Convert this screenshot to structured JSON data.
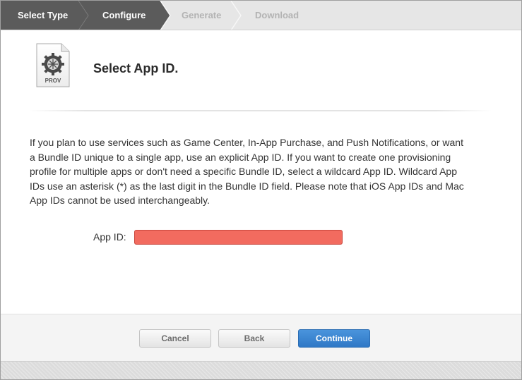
{
  "steps": [
    {
      "label": "Select Type",
      "state": "done"
    },
    {
      "label": "Configure",
      "state": "done"
    },
    {
      "label": "Generate",
      "state": "todo"
    },
    {
      "label": "Download",
      "state": "todo"
    }
  ],
  "colors": {
    "step_done": "#5b5b5b",
    "step_todo": "#e6e6e6",
    "app_id_field": "#f26b5f",
    "primary_button": "#2f78c6"
  },
  "header": {
    "icon_name": "provisioning-profile-icon",
    "icon_label": "PROV",
    "title": "Select App ID."
  },
  "description": "If you plan to use services such as Game Center, In-App Purchase, and Push Notifications, or want a Bundle ID unique to a single app, use an explicit App ID. If you want to create one provisioning profile for multiple apps or don't need a specific Bundle ID, select a wildcard App ID. Wildcard App IDs use an asterisk (*) as the last digit in the Bundle ID field. Please note that iOS App IDs and Mac App IDs cannot be used interchangeably.",
  "form": {
    "app_id_label": "App ID:",
    "app_id_value": ""
  },
  "footer": {
    "cancel_label": "Cancel",
    "back_label": "Back",
    "continue_label": "Continue"
  }
}
